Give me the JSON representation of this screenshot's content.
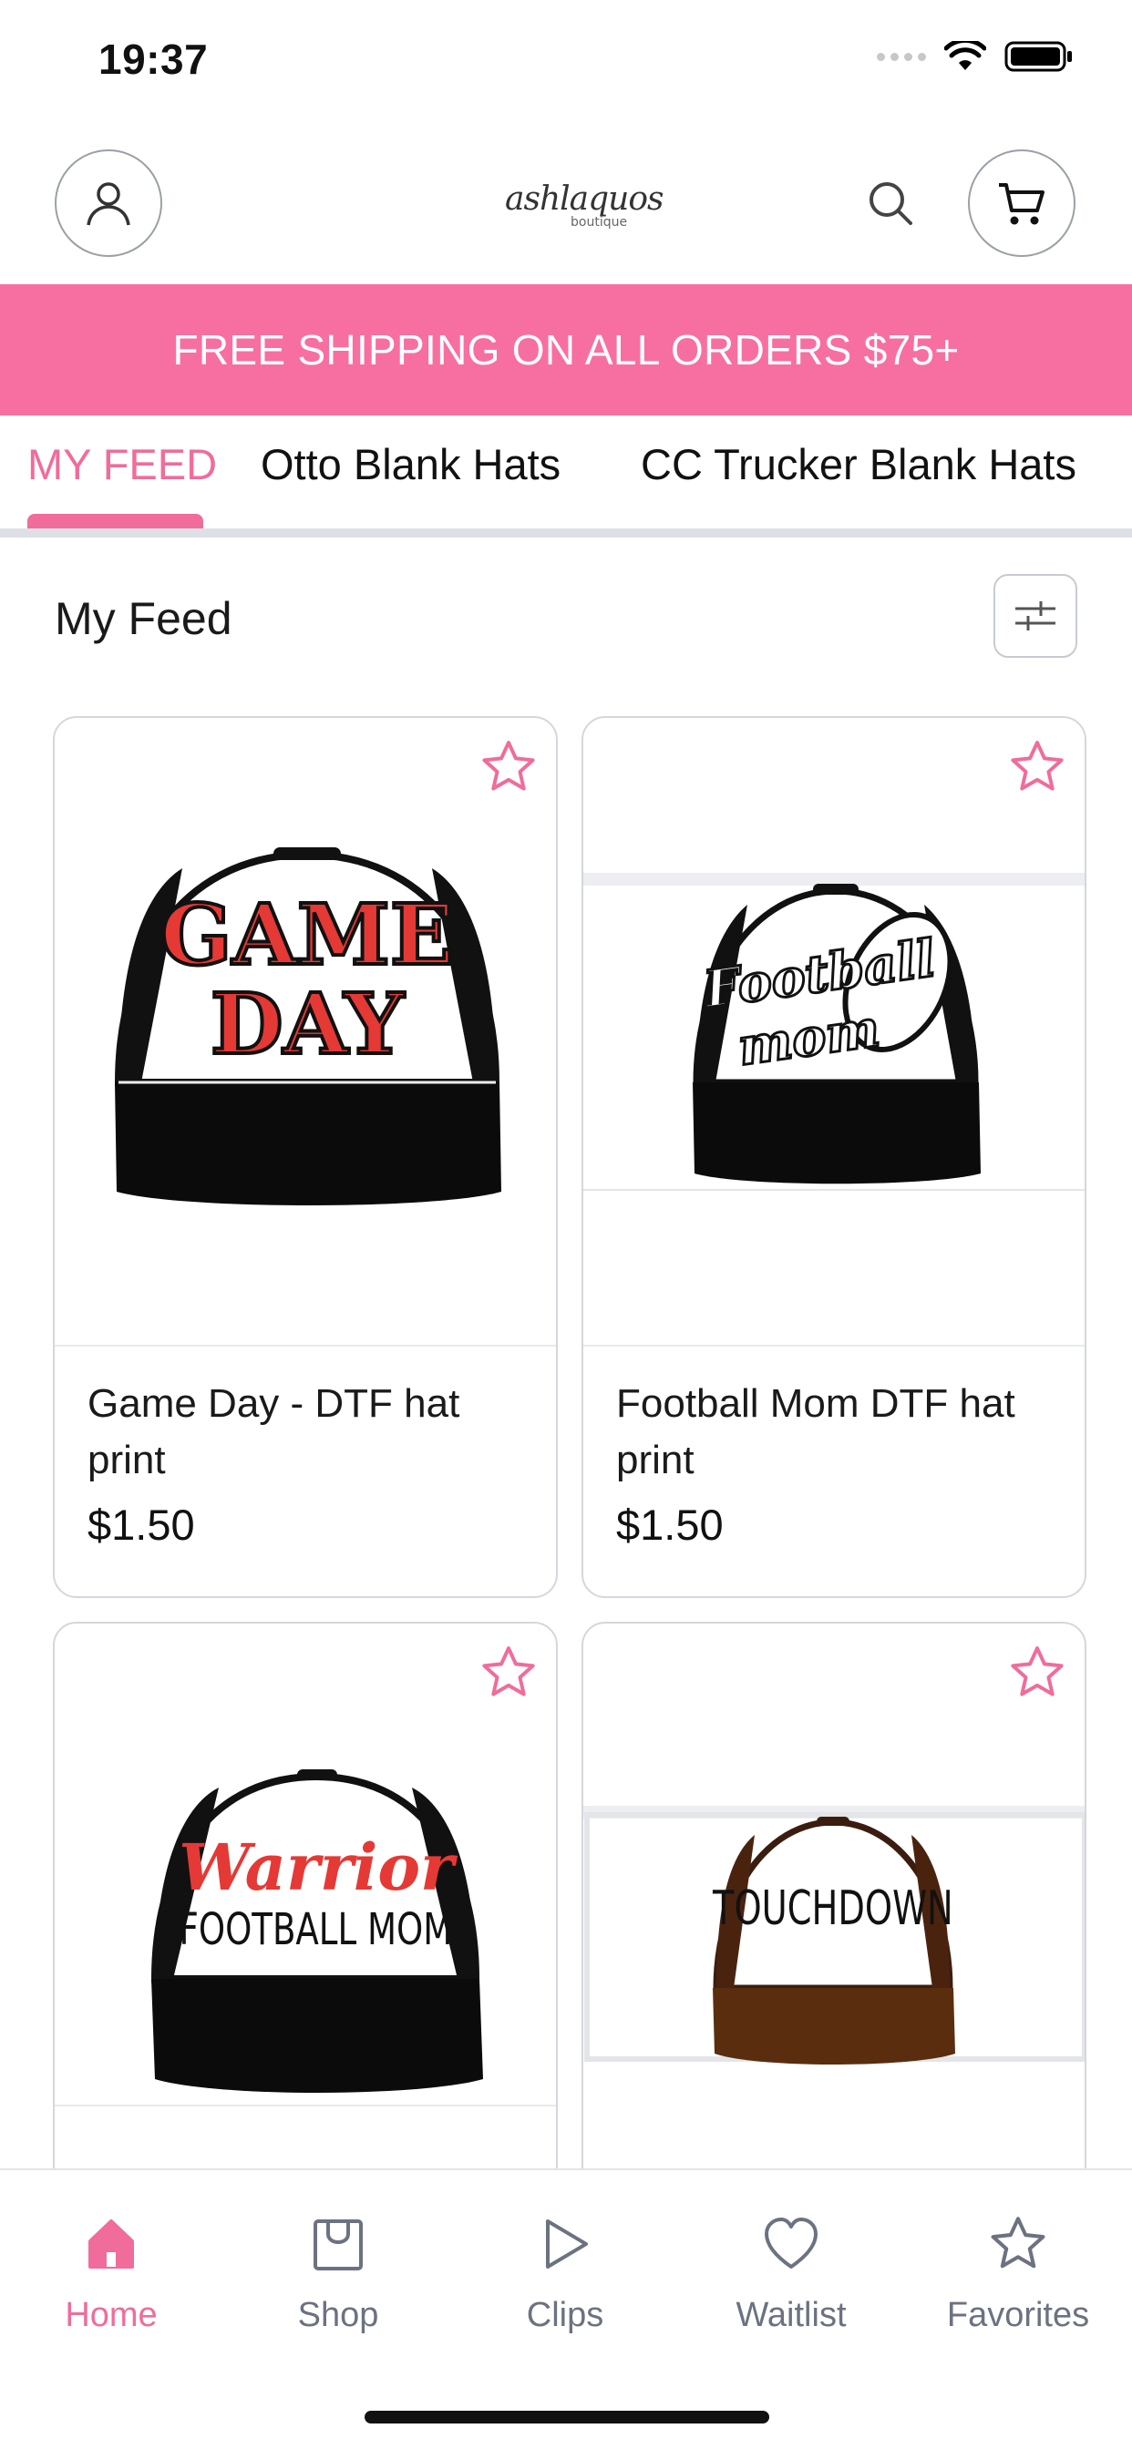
{
  "status_bar": {
    "time": "19:37"
  },
  "header": {
    "logo_script": "ashlaquos",
    "logo_sub": "boutique"
  },
  "promo": {
    "text": "FREE SHIPPING ON ALL ORDERS $75+"
  },
  "tabs": [
    {
      "label": "MY FEED",
      "active": true
    },
    {
      "label": "Otto Blank Hats",
      "active": false
    },
    {
      "label": "CC Trucker Blank Hats",
      "active": false
    }
  ],
  "feed": {
    "title": "My Feed"
  },
  "products": [
    {
      "title": "Game Day - DTF hat print",
      "price": "$1.50",
      "print_lines": [
        "GAME",
        "DAY"
      ],
      "print_color": "#e53935"
    },
    {
      "title": "Football Mom DTF hat print",
      "price": "$1.50",
      "print_lines": [
        "Football",
        "mom"
      ],
      "print_color": "#111111"
    },
    {
      "title": "",
      "price": "",
      "print_lines": [
        "Warrior",
        "FOOTBALL MOM"
      ],
      "print_color": "#e53935"
    },
    {
      "title": "",
      "price": "",
      "print_lines": [
        "TOUCHDOWN"
      ],
      "print_color": "#111111"
    }
  ],
  "bottom_nav": [
    {
      "label": "Home",
      "icon": "home-icon",
      "active": true
    },
    {
      "label": "Shop",
      "icon": "shopping-bag-icon",
      "active": false
    },
    {
      "label": "Clips",
      "icon": "play-icon",
      "active": false
    },
    {
      "label": "Waitlist",
      "icon": "heart-icon",
      "active": false
    },
    {
      "label": "Favorites",
      "icon": "star-icon",
      "active": false
    }
  ],
  "colors": {
    "accent": "#f06c9b",
    "promo_bg": "#f76fa0",
    "muted": "#6b7280"
  }
}
